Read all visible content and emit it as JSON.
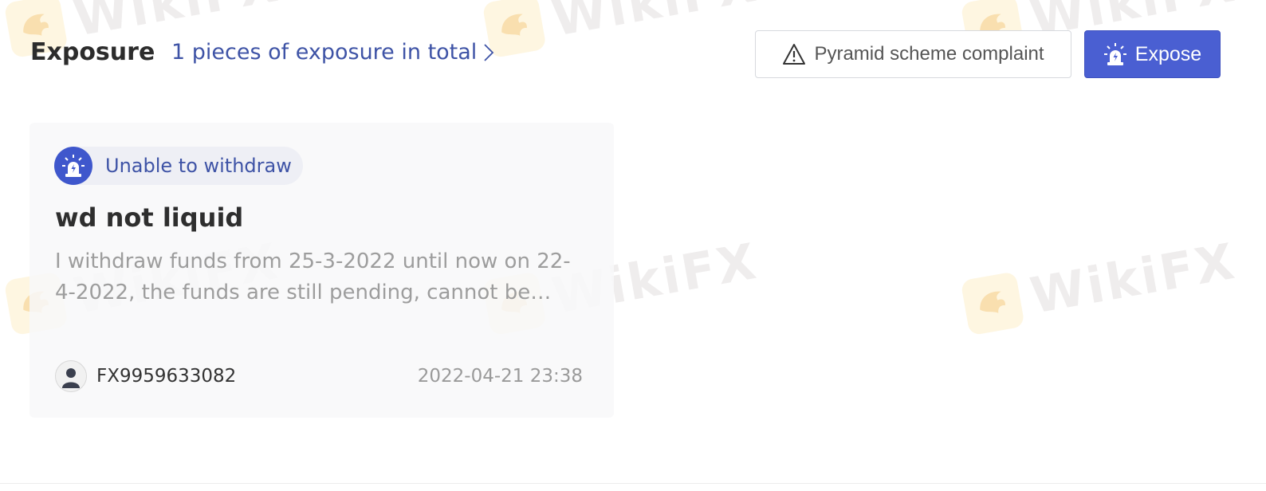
{
  "header": {
    "title": "Exposure",
    "total_text": "1 pieces of exposure in total",
    "complaint_button": "Pyramid scheme complaint",
    "expose_button": "Expose"
  },
  "exposures": [
    {
      "tag": "Unable to withdraw",
      "title": "wd not liquid",
      "description": "I withdraw funds from 25-3-2022 until now on 22-4-2022, the funds are still pending, cannot be withdrawn",
      "author": "FX9959633082",
      "date": "2022-04-21 23:38"
    }
  ],
  "watermark": {
    "text": "WikiFX"
  },
  "icons": {
    "total_link": "chevron-right-icon",
    "complaint": "warning-triangle-icon",
    "expose": "alarm-siren-icon",
    "tag": "alarm-siren-icon",
    "author": "user-avatar-icon",
    "watermark": "eagle-logo-icon"
  },
  "colors": {
    "accent": "#4a5fd2",
    "link": "#3e53a6",
    "title_text": "#2c2c2c",
    "muted_text": "#9d9d9d",
    "card_bg": "#f8f8f9",
    "tag_bg": "#eeeff5"
  }
}
